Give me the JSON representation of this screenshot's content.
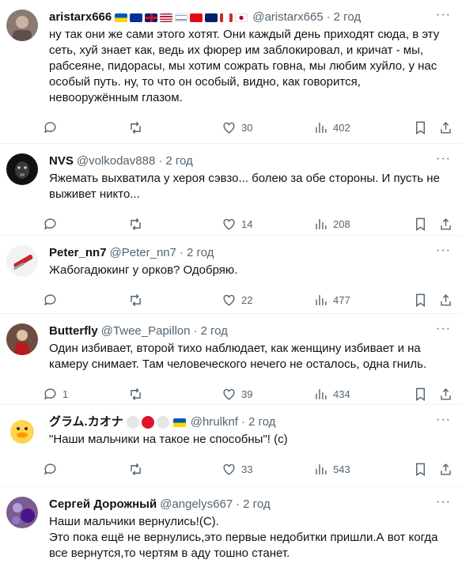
{
  "tweets": [
    {
      "name": "aristarx666",
      "handle": "@aristarx665",
      "time": "2 год",
      "text": "ну так они же сами этого хотят. Они каждый день приходят сюда, в эту сеть, хуй знает как, ведь их фюрер им заблокировал, и кричат - мы, рабсеяне, пидорасы, мы хотим сожрать говна, мы любим хуйло, у нас особый путь. ну, то что он особый, видно, как говорится, невооружённым глазом.",
      "replies": "",
      "likes": "30",
      "views": "402"
    },
    {
      "name": "NVS",
      "handle": "@volkodav888",
      "time": "2 год",
      "text": "Яжемать выхватила у хероя сэвзо... болею за обе стороны. И пусть не выживет никто...",
      "replies": "",
      "likes": "14",
      "views": "208"
    },
    {
      "name": "Peter_nn7",
      "handle": "@Peter_nn7",
      "time": "2 год",
      "text": "Жабогадюкинг у орков? Одобряю.",
      "replies": "",
      "likes": "22",
      "views": "477"
    },
    {
      "name": "Butterfly",
      "handle": "@Twee_Papillon",
      "time": "2 год",
      "text": "Один избивает, второй тихо наблюдает, как женщину избивает и на камеру снимает. Там человеческого нечего не осталось, одна гниль.",
      "replies": "1",
      "likes": "39",
      "views": "434"
    },
    {
      "name": "グラム.カオナ",
      "handle": "@hrulknf",
      "time": "2 год",
      "text": "\"Наши мальчики на такое не способны\"! (с)",
      "replies": "",
      "likes": "33",
      "views": "543"
    },
    {
      "name": "Сергей Дорожный",
      "handle": "@angelys667",
      "time": "2 год",
      "text": "Наши мальчики вернулись!(С).\nЭто пока ещё не вернулись,это первые недобитки пришли.А вот когда все вернутся,то чертям в аду тошно станет.",
      "replies": "",
      "likes": "",
      "views": ""
    }
  ],
  "separator": "·",
  "icons": [
    "reply-icon",
    "retweet-icon",
    "like-icon",
    "views-icon",
    "bookmark-icon",
    "share-icon",
    "more-icon"
  ],
  "colors": {
    "text": "#0f1419",
    "secondary": "#536471",
    "border": "#eff3f4"
  }
}
